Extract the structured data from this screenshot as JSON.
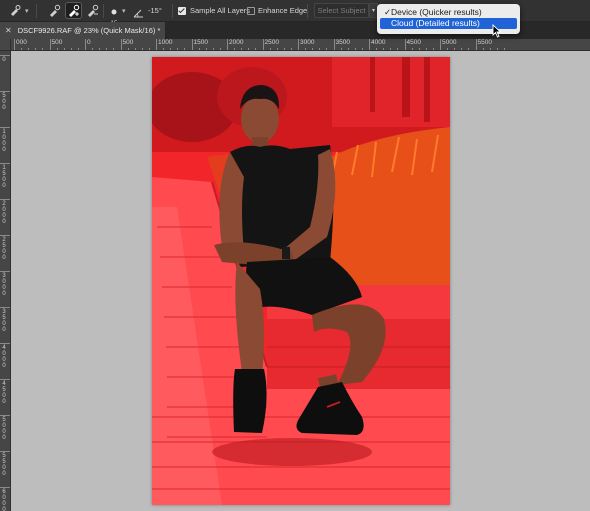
{
  "options_bar": {
    "brush_size": "15",
    "angle_value": "-15°",
    "sample_all_layers_label": "Sample All Layers",
    "sample_all_layers_checked": true,
    "enhance_edge_label": "Enhance Edge",
    "enhance_edge_checked": false,
    "select_subject_label": "Select Subject",
    "tool_icons": [
      "quick-selection-brush-icon",
      "add-to-selection-brush-icon",
      "subtract-from-selection-brush-icon",
      "brush-settings-icon",
      "angle-icon"
    ]
  },
  "dropdown": {
    "items": [
      {
        "label": "Device (Quicker results)",
        "checked": true,
        "highlighted": false
      },
      {
        "label": "Cloud (Detailed results)",
        "checked": false,
        "highlighted": true
      }
    ]
  },
  "document_tab": {
    "title": "DSCF9926.RAF @ 23% (Quick Mask/16) *",
    "close_icon": "close-icon"
  },
  "rulers": {
    "top_labels": [
      "000",
      "500",
      "0",
      "500",
      "1000",
      "1500",
      "2000",
      "2500",
      "3000",
      "3500",
      "4000",
      "4500",
      "5000",
      "5500"
    ],
    "left_labels": [
      "0",
      "500",
      "1000",
      "1500",
      "2000",
      "2500",
      "3000",
      "3500",
      "4000",
      "4500",
      "5000",
      "5500",
      "6000"
    ]
  },
  "colors": {
    "quick_mask_overlay": "#ff2a2a",
    "canvas_background": "#bdbdbd",
    "dropdown_highlight": "#1f63d6",
    "panel_background": "#323232"
  }
}
